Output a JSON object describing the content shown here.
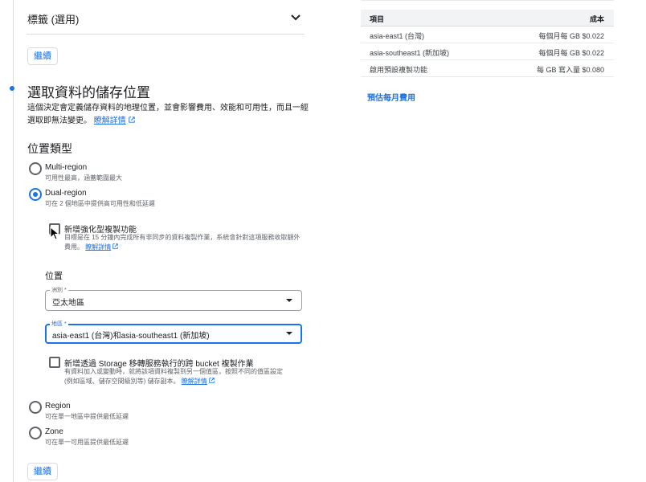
{
  "labels_section": {
    "title": "標籤 (選用)",
    "continue_label": "繼續"
  },
  "storage_location": {
    "title": "選取資料的儲存位置",
    "description": "這個決定會定義儲存資料的地理位置，並會影響費用、效能和可用性，而且一經選取即無法變更。",
    "learn_more": "瞭解詳情",
    "location_type_title": "位置類型",
    "options": [
      {
        "label": "Multi-region",
        "desc": "可用性最高，涵蓋範圍最大",
        "selected": false
      },
      {
        "label": "Dual-region",
        "desc": "可在 2 個地區中提供高可用性和低延遲",
        "selected": true
      },
      {
        "label": "Region",
        "desc": "可在單一地區中提供最低延遲",
        "selected": false
      },
      {
        "label": "Zone",
        "desc": "可在單一可用區提供最低延遲",
        "selected": false
      }
    ],
    "turbo_replication": {
      "label": "新增強化型複製功能",
      "desc": "目標是在 15 分鐘內完成所有非同步的資料複製作業，系統會針對這項服務收取額外費用。",
      "learn_more": "瞭解詳情",
      "checked": false
    },
    "location_title": "位置",
    "continent_field": {
      "label": "洲別 *",
      "value": "亞太地區"
    },
    "regions_field": {
      "label": "地區 *",
      "value": "asia-east1 (台灣)和asia-southeast1 (新加坡)"
    },
    "cross_bucket": {
      "label": "新增透過 Storage 移轉服務執行的跨 bucket 複製作業",
      "desc_line1": "有資料加入或變動時，就將該項資料複製到另一個值區，按照不同的值區設定",
      "desc_line2": "(例如區域、儲存空間級別等) 儲存副本。",
      "learn_more": "瞭解詳情",
      "checked": false
    },
    "continue_label": "繼續"
  },
  "cost_table": {
    "headers": {
      "item": "項目",
      "cost": "成本"
    },
    "rows": [
      {
        "item": "asia-east1 (台灣)",
        "cost": "每個月每 GB $0.022"
      },
      {
        "item": "asia-southeast1 (新加坡)",
        "cost": "每個月每 GB $0.022"
      },
      {
        "item": "啟用預設複製功能",
        "cost": "每 GB 寫入量 $0.080"
      }
    ],
    "estimate_link": "預估每月費用"
  },
  "colors": {
    "accent": "#1a73e8",
    "text": "#202124",
    "secondary": "#5f6368",
    "border": "#dadce0"
  }
}
